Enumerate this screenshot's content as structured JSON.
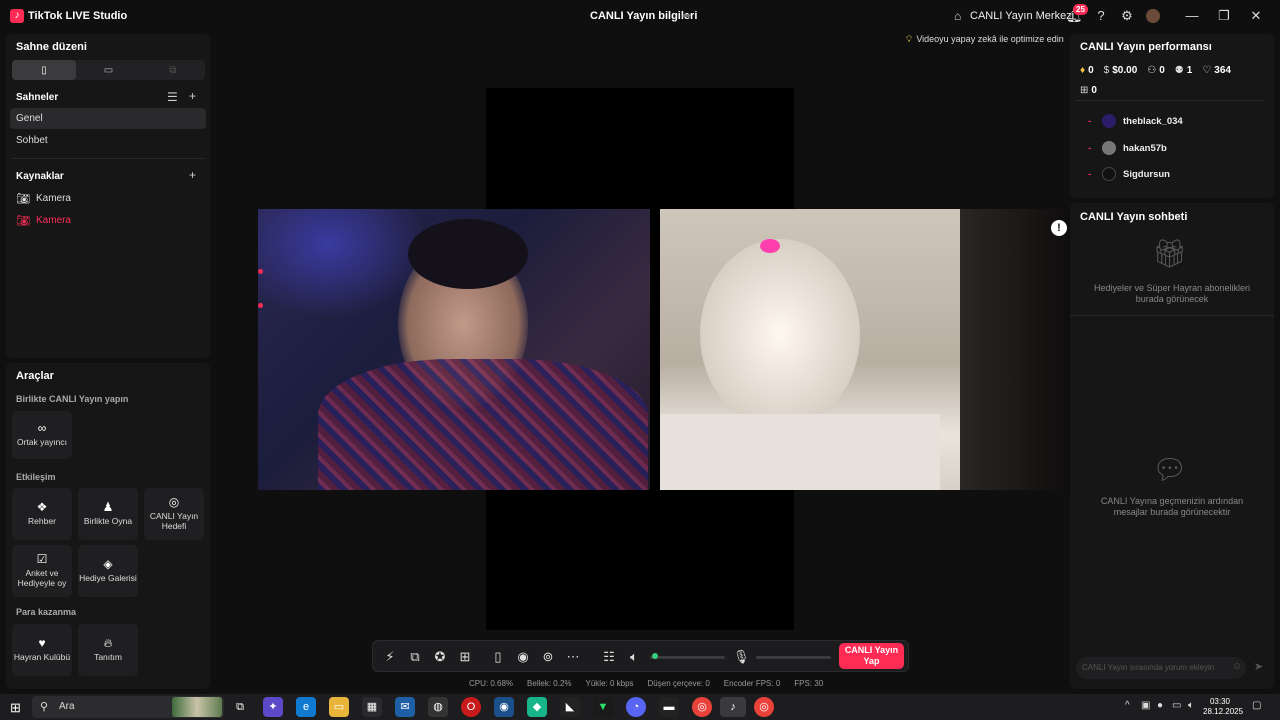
{
  "app": {
    "title": "TikTok LIVE Studio",
    "center_title": "CANLI Yayın bilgileri",
    "live_center": "CANLI Yayın Merkezi",
    "notifications_count": "25"
  },
  "left": {
    "scene_layout_title": "Sahne düzeni",
    "scenes_title": "Sahneler",
    "scenes": [
      "Genel",
      "Sohbet"
    ],
    "sources_title": "Kaynaklar",
    "sources": [
      "Kamera",
      "Kamera"
    ],
    "tools_title": "Araçlar",
    "cohost_section": "Birlikte CANLI Yayın yapın",
    "cohost_tools": [
      "Ortak yayıncı"
    ],
    "engagement_section": "Etkileşim",
    "engagement_tools": [
      "Rehber",
      "Birlikte Oyna",
      "CANLI Yayın Hedefi",
      "Anket ve Hediyeyle oy",
      "Hediye Galerisi"
    ],
    "earn_section": "Para kazanma",
    "earn_tools": [
      "Hayran Kulübü",
      "Tanıtım"
    ]
  },
  "stage": {
    "optimize_text": "Videoyu yapay zekâ ile optimize edin"
  },
  "toolbar": {
    "go_live": "CANLI Yayın Yap",
    "volume_level": 0.02,
    "mic_level": 0.0
  },
  "stats": {
    "cpu": "CPU: 0.68%",
    "memory": "Bellek: 0.2%",
    "upload": "Yükle: 0 kbps",
    "dropped": "Düşen çerçeve: 0",
    "encoder_fps": "Encoder FPS: 0",
    "fps": "FPS: 30"
  },
  "performance": {
    "title": "CANLI Yayın performansı",
    "diamonds": "0",
    "earnings": "$0.00",
    "viewers": "0",
    "followers": "1",
    "likes": "364",
    "gifts": "0",
    "top_viewers": [
      "theblack_034",
      "hakan57b",
      "Sigdursun"
    ],
    "top_viewer_rank_marker": "-"
  },
  "chat": {
    "title": "CANLI Yayın sohbeti",
    "gifts_empty": "Hediyeler ve Süper Hayran abonelikleri burada görünecek",
    "chat_empty": "CANLI Yayına geçmenizin ardından mesajlar burada görünecektir",
    "input_placeholder": "CANLI Yayın sırasında yorum ekleyin"
  },
  "taskbar": {
    "search_label": "Ara",
    "time": "03:30",
    "date": "28.12.2025"
  },
  "colors": {
    "accent": "#fe2c55",
    "bg": "#0f0f10",
    "panel": "#161617"
  }
}
